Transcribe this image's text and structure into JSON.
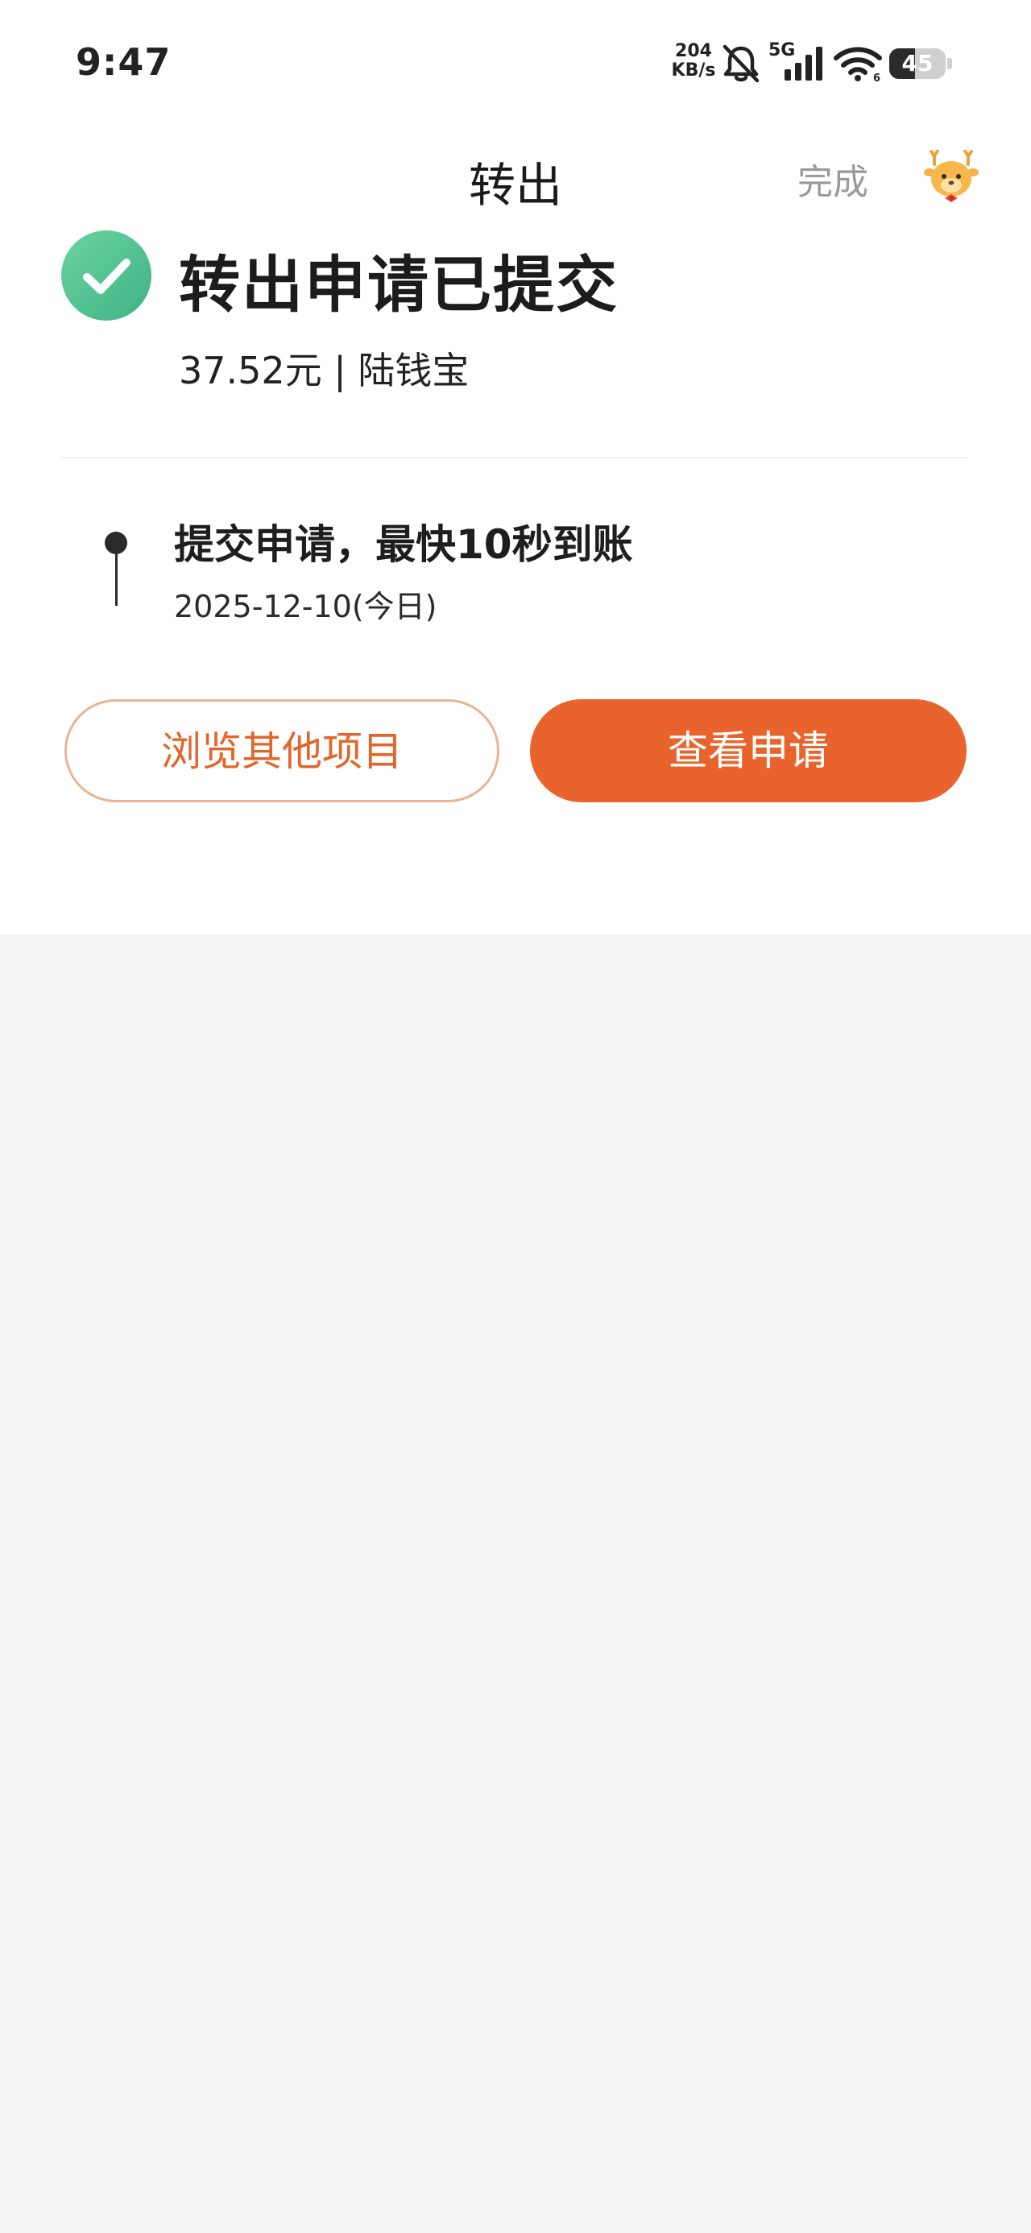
{
  "status_bar": {
    "time": "9:47",
    "net_speed_value": "204",
    "net_speed_unit": "KB/s",
    "network_label": "5G",
    "battery_level": "45",
    "battery_percent": 45
  },
  "nav": {
    "title": "转出",
    "done_label": "完成",
    "mascot_icon": "mascot-deer-icon"
  },
  "result": {
    "icon": "check-circle-icon",
    "icon_color": "#4fc08d",
    "title": "转出申请已提交",
    "amount_line": "37.52元 | 陆钱宝"
  },
  "timeline": {
    "steps": [
      {
        "title": "提交申请，最快10秒到账",
        "date": "2025-12-10(今日)"
      }
    ]
  },
  "actions": {
    "browse_label": "浏览其他项目",
    "view_label": "查看申请",
    "accent_color": "#e8642c"
  }
}
